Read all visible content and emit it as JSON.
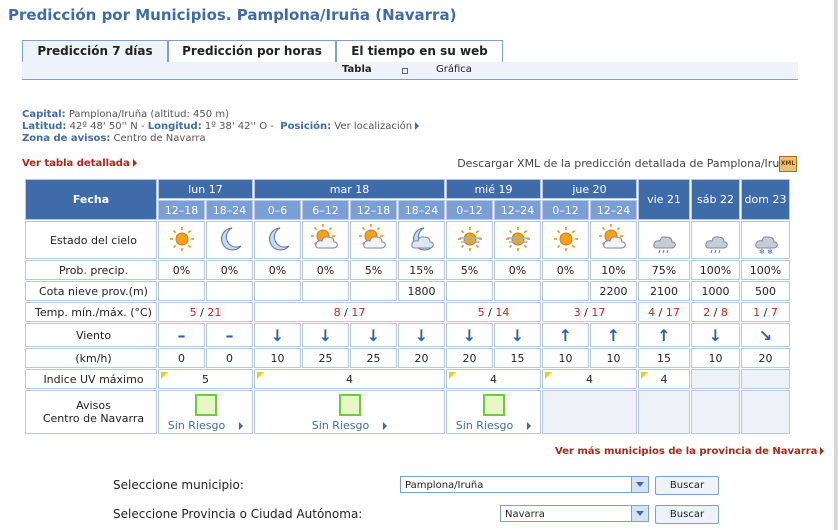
{
  "page_title": "Predicción por Municipios. Pamplona/Iruña (Navarra)",
  "tabs": [
    "Predicción 7 días",
    "Predicción por horas",
    "El tiempo en su web"
  ],
  "subtabs": {
    "tabla": "Tabla",
    "grafica": "Gráfica"
  },
  "info": {
    "capital_label": "Capital:",
    "capital_value": "Pamplona/Iruña (altitud: 450 m)",
    "latitud_label": "Latitud:",
    "latitud_value": "42º 48' 50'' N -",
    "longitud_label": "Longitud:",
    "longitud_value": "1º 38' 42'' O -",
    "posicion_label": "Posición:",
    "posicion_value": "Ver localización",
    "zona_label": "Zona de avisos:",
    "zona_value": "Centro de Navarra"
  },
  "ver_tabla": "Ver tabla detallada",
  "xml_download": "Descargar XML de la predicción detallada de Pamplona/Iruña",
  "xml_icon": "XML",
  "table": {
    "fecha_label": "Fecha",
    "days": [
      {
        "label": "lun 17",
        "periods": [
          "12–18",
          "18–24"
        ]
      },
      {
        "label": "mar 18",
        "periods": [
          "0–6",
          "6–12",
          "12–18",
          "18–24"
        ]
      },
      {
        "label": "mié 19",
        "periods": [
          "0–12",
          "12–24"
        ]
      },
      {
        "label": "jue 20",
        "periods": [
          "0–12",
          "12–24"
        ]
      },
      {
        "label": "vie 21",
        "periods": []
      },
      {
        "label": "sáb 22",
        "periods": []
      },
      {
        "label": "dom 23",
        "periods": []
      }
    ],
    "row_labels": {
      "cielo": "Estado del cielo",
      "precip": "Prob. precip.",
      "nieve": "Cota nieve prov.(m)",
      "temp": "Temp. mín./máx. (°C)",
      "viento": "Viento",
      "kmh": "(km/h)",
      "uv": "Indice UV máximo",
      "avisos_1": "Avisos",
      "avisos_2": "Centro de Navarra"
    },
    "cielo_icons": [
      "sun-icon",
      "moon-icon",
      "moon-icon",
      "sun-cloud-icon",
      "sun-cloud-icon",
      "moon-cloud-icon",
      "sun-haze-icon",
      "sun-haze-icon",
      "sun-icon",
      "sun-cloud-icon",
      "cloud-rain-icon",
      "cloud-rain-icon",
      "cloud-snow-icon"
    ],
    "precip": [
      "0%",
      "0%",
      "0%",
      "0%",
      "5%",
      "15%",
      "5%",
      "0%",
      "0%",
      "10%",
      "75%",
      "100%",
      "100%"
    ],
    "nieve": [
      "",
      "",
      "",
      "",
      "",
      "1800",
      "",
      "",
      "",
      "2200",
      "2100",
      "1000",
      "500"
    ],
    "temps": [
      {
        "min": "5",
        "max": "21"
      },
      {
        "min": "8",
        "max": "17"
      },
      {
        "min": "5",
        "max": "14"
      },
      {
        "min": "3",
        "max": "17"
      },
      {
        "min": "4",
        "max": "17"
      },
      {
        "min": "2",
        "max": "8"
      },
      {
        "min": "1",
        "max": "7"
      }
    ],
    "viento": [
      "–",
      "–",
      "↓",
      "↓",
      "↓",
      "↓",
      "↓",
      "↓",
      "↑",
      "↑",
      "↑",
      "↓",
      "↘"
    ],
    "kmh": [
      "0",
      "0",
      "10",
      "25",
      "25",
      "20",
      "20",
      "15",
      "10",
      "10",
      "15",
      "10",
      "20"
    ],
    "uv": [
      "5",
      "4",
      "4",
      "4",
      "4"
    ],
    "avisos": [
      "Sin Riesgo",
      "Sin Riesgo",
      "Sin Riesgo"
    ]
  },
  "ver_mas": "Ver más municipios de la provincia de Navarra",
  "form": {
    "municipio_label": "Seleccione municipio:",
    "municipio_value": "Pamplona/Iruña",
    "provincia_label": "Seleccione Provincia o Ciudad Autónoma:",
    "provincia_value": "Navarra",
    "buscar": "Buscar"
  },
  "colors": {
    "accent": "#3f6ba8",
    "header_light": "#7a9fd4",
    "max_temp": "#c8261c",
    "link_red": "#b5231b"
  }
}
